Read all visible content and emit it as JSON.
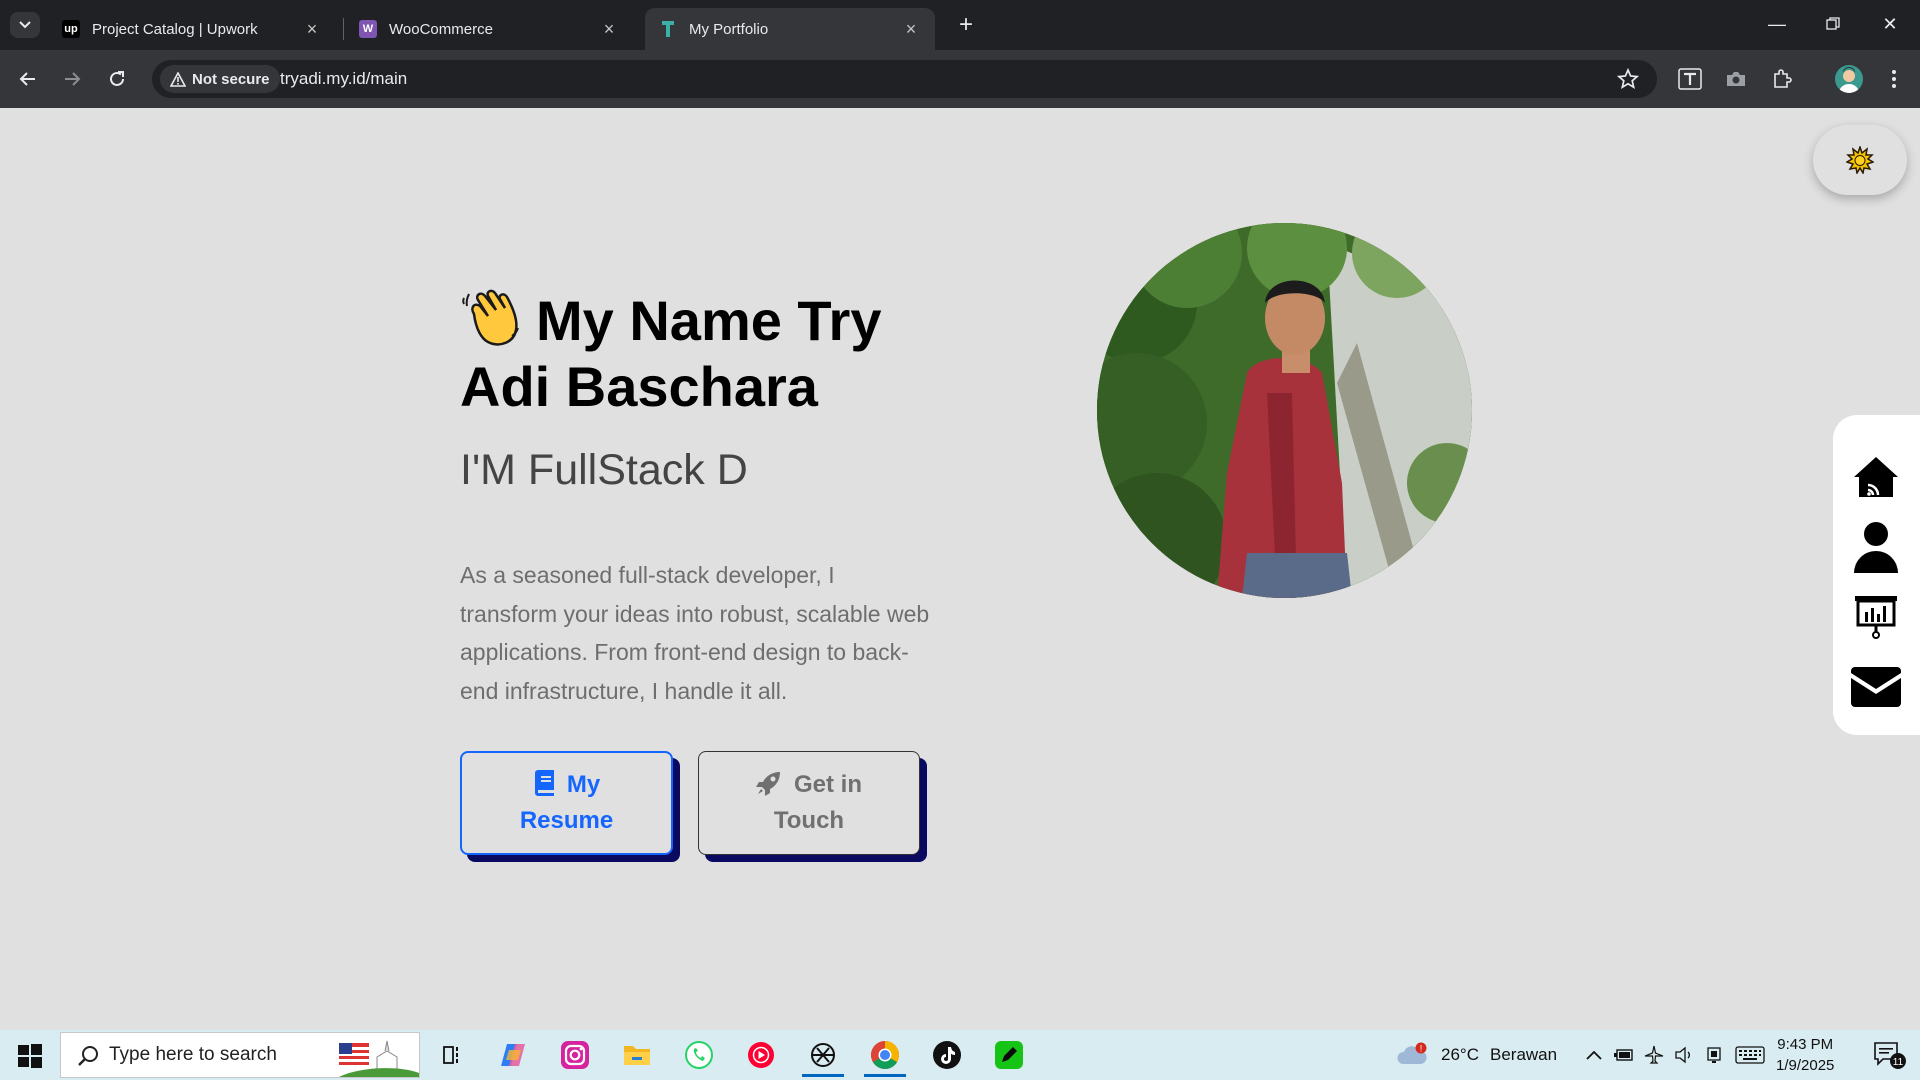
{
  "browser": {
    "tabs": [
      {
        "title": "Project Catalog | Upwork",
        "favicon": "upwork-icon"
      },
      {
        "title": "WooCommerce",
        "favicon": "woocommerce-icon"
      },
      {
        "title": "My Portfolio",
        "favicon": "portfolio-icon",
        "active": true
      }
    ],
    "security_label": "Not secure",
    "url": "tryadi.my.id/main"
  },
  "hero": {
    "greeting_icon": "waving-hand-icon",
    "title": "My Name Try Adi Baschara",
    "subtitle": "I'M FullStack D",
    "description": "As a seasoned full-stack developer, I transform your ideas into robust, scalable web applications. From front-end design to back-end infrastructure, I handle it all.",
    "resume_button": {
      "label_line1": "My",
      "label_line2": "Resume",
      "icon": "book-icon"
    },
    "contact_button": {
      "label_line1": "Get in",
      "label_line2": "Touch",
      "icon": "rocket-icon"
    }
  },
  "side_nav": {
    "items": [
      "home-icon",
      "user-icon",
      "presentation-icon",
      "envelope-icon"
    ]
  },
  "theme_toggle": {
    "icon": "sun-icon"
  },
  "taskbar": {
    "search_placeholder": "Type here to search",
    "weather_temp": "26°C",
    "weather_text": "Berawan",
    "weather_alert": "!",
    "time": "9:43 PM",
    "date": "1/9/2025",
    "notification_count": "11"
  },
  "colors": {
    "page_bg": "#e0e0e0",
    "primary_blue": "#1565ff",
    "button_shadow": "#0a0a60",
    "chrome_dark": "#202124",
    "taskbar_bg": "#d9ecf2"
  }
}
